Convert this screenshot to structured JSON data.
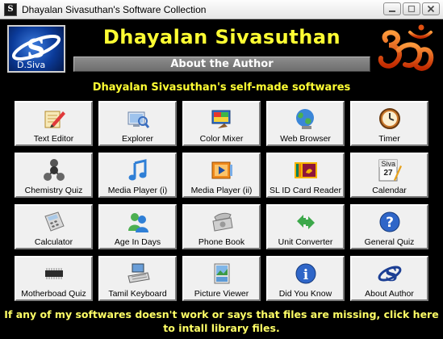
{
  "window": {
    "title": "Dhayalan Sivasuthan's Software Collection",
    "icon_name": "app-icon",
    "buttons": [
      "minimize",
      "maximize",
      "close"
    ]
  },
  "header": {
    "logo_caption": "D.Siva",
    "author_name": "Dhayalan Sivasuthan",
    "about_label": "About the Author",
    "subtitle": "Dhayalan Sivasuthan's self-made softwares"
  },
  "colors": {
    "background": "#000000",
    "accent_text": "#ffff33",
    "tile_face": "#f0f0f0"
  },
  "apps": [
    {
      "label": "Text Editor",
      "icon": "pencil-notepad-icon"
    },
    {
      "label": "Explorer",
      "icon": "explorer-icon"
    },
    {
      "label": "Color Mixer",
      "icon": "color-mixer-icon"
    },
    {
      "label": "Web Browser",
      "icon": "globe-icon"
    },
    {
      "label": "Timer",
      "icon": "clock-icon"
    },
    {
      "label": "Chemistry Quiz",
      "icon": "molecule-icon"
    },
    {
      "label": "Media Player (i)",
      "icon": "music-note-icon"
    },
    {
      "label": "Media Player (ii)",
      "icon": "film-player-icon"
    },
    {
      "label": "SL ID Card Reader",
      "icon": "sri-lanka-flag-icon"
    },
    {
      "label": "Calendar",
      "icon": "calendar-icon",
      "calendar_text": "Siva",
      "calendar_day": "27"
    },
    {
      "label": "Calculator",
      "icon": "calculator-icon"
    },
    {
      "label": "Age In Days",
      "icon": "people-icon"
    },
    {
      "label": "Phone Book",
      "icon": "telephone-icon"
    },
    {
      "label": "Unit Converter",
      "icon": "arrows-icon"
    },
    {
      "label": "General Quiz",
      "icon": "question-icon"
    },
    {
      "label": "Motherboad Quiz",
      "icon": "chip-icon"
    },
    {
      "label": "Tamil Keyboard",
      "icon": "keyboard-icon"
    },
    {
      "label": "Picture Viewer",
      "icon": "picture-icon"
    },
    {
      "label": "Did You Know",
      "icon": "info-icon"
    },
    {
      "label": "About Author",
      "icon": "author-logo-icon"
    }
  ],
  "footer": {
    "line1": "If any of my softwares doesn't work or says that files are  missing, click here",
    "line2": "to intall library files."
  }
}
